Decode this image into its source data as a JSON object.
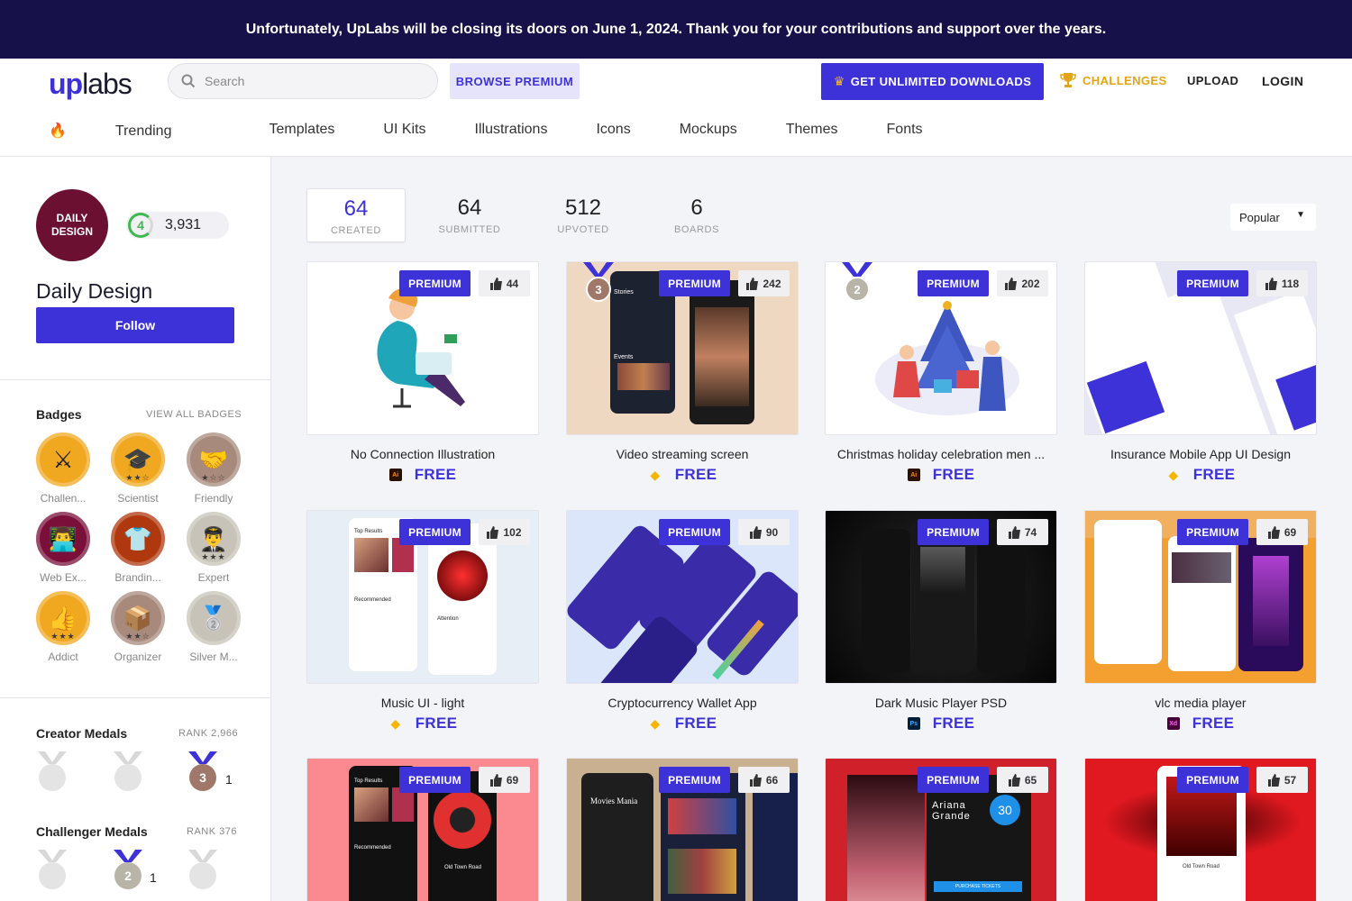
{
  "banner": {
    "text": "Unfortunately, UpLabs will be closing its doors on June 1, 2024. Thank you for your contributions and support over the years."
  },
  "header": {
    "logo_up": "up",
    "logo_labs": "labs",
    "search_placeholder": "Search",
    "browse_premium": "BROWSE PREMIUM",
    "unlimited": "GET UNLIMITED DOWNLOADS",
    "challenges": "CHALLENGES",
    "upload": "UPLOAD",
    "login": "LOGIN",
    "categories": [
      "Trending",
      "Templates",
      "UI Kits",
      "Illustrations",
      "Icons",
      "Mockups",
      "Themes",
      "Fonts"
    ],
    "accent": "#3d31d8"
  },
  "profile": {
    "avatar_text": "DAILY\nDESIGN",
    "level": "4",
    "points": "3,931",
    "name": "Daily Design",
    "follow": "Follow"
  },
  "badges": {
    "title": "Badges",
    "view_all": "VIEW ALL BADGES",
    "items": [
      {
        "label": "Challen...",
        "icon": "knight-icon",
        "glyph": "⚔",
        "stars": "",
        "color": "#f0a820"
      },
      {
        "label": "Scientist",
        "icon": "graduation-cap-icon",
        "glyph": "🎓",
        "stars": "★★☆",
        "color": "#f0a820"
      },
      {
        "label": "Friendly",
        "icon": "handshake-icon",
        "glyph": "🤝",
        "stars": "★☆☆",
        "color": "#a88a7c"
      },
      {
        "label": "Web Ex...",
        "icon": "developer-icon",
        "glyph": "👨‍💻",
        "stars": "",
        "color": "#7a0f3a"
      },
      {
        "label": "Brandin...",
        "icon": "tshirt-icon",
        "glyph": "👕",
        "stars": "",
        "color": "#b0380f"
      },
      {
        "label": "Expert",
        "icon": "expert-icon",
        "glyph": "👨‍✈️",
        "stars": "★★★",
        "color": "#c7c3b8"
      },
      {
        "label": "Addict",
        "icon": "thumbs-up-icon",
        "glyph": "👍",
        "stars": "★★★",
        "color": "#f0a820"
      },
      {
        "label": "Organizer",
        "icon": "box-icon",
        "glyph": "📦",
        "stars": "★★☆",
        "color": "#a88a7c"
      },
      {
        "label": "Silver M...",
        "icon": "silver-medal-icon",
        "glyph": "🥈",
        "stars": "",
        "color": "#c7c3b8"
      }
    ]
  },
  "creator_medals": {
    "title": "Creator Medals",
    "rank": "RANK 2,966",
    "bronze_count": "1",
    "bronze_num": "3"
  },
  "challenger_medals": {
    "title": "Challenger Medals",
    "rank": "RANK 376",
    "silver_count": "1",
    "silver_num": "2"
  },
  "stats": [
    {
      "num": "64",
      "label": "CREATED"
    },
    {
      "num": "64",
      "label": "SUBMITTED"
    },
    {
      "num": "512",
      "label": "UPVOTED"
    },
    {
      "num": "6",
      "label": "BOARDS"
    }
  ],
  "sort": {
    "selected": "Popular"
  },
  "cards": [
    {
      "title": "No Connection Illustration",
      "likes": "44",
      "price": "FREE",
      "app": "Ai",
      "premium": "PREMIUM"
    },
    {
      "title": "Video streaming screen",
      "likes": "242",
      "price": "FREE",
      "app": "Sketch",
      "premium": "PREMIUM",
      "medal": "3"
    },
    {
      "title": "Christmas holiday celebration men ...",
      "likes": "202",
      "price": "FREE",
      "app": "Ai",
      "premium": "PREMIUM",
      "medal": "2"
    },
    {
      "title": "Insurance Mobile App UI Design",
      "likes": "118",
      "price": "FREE",
      "app": "Sketch",
      "premium": "PREMIUM"
    },
    {
      "title": "Music UI - light",
      "likes": "102",
      "price": "FREE",
      "app": "Sketch",
      "premium": "PREMIUM"
    },
    {
      "title": "Cryptocurrency Wallet App",
      "likes": "90",
      "price": "FREE",
      "app": "Sketch",
      "premium": "PREMIUM"
    },
    {
      "title": "Dark Music Player PSD",
      "likes": "74",
      "price": "FREE",
      "app": "Ps",
      "premium": "PREMIUM"
    },
    {
      "title": "vlc media player",
      "likes": "69",
      "price": "FREE",
      "app": "Xd",
      "premium": "PREMIUM"
    },
    {
      "title": "",
      "likes": "69",
      "price": "",
      "app": "",
      "premium": "PREMIUM"
    },
    {
      "title": "",
      "likes": "66",
      "price": "",
      "app": "",
      "premium": "PREMIUM"
    },
    {
      "title": "",
      "likes": "65",
      "price": "",
      "app": "",
      "premium": "PREMIUM"
    },
    {
      "title": "",
      "likes": "57",
      "price": "",
      "app": "",
      "premium": "PREMIUM"
    }
  ],
  "thumb_text": {
    "c2_stories": "Stories",
    "c2_events": "Events",
    "c5_top": "Top Results",
    "c5_rec": "Recommended",
    "c5_track": "Attention",
    "c9_top": "Top Results",
    "c9_rec": "Recommended",
    "c9_track": "Old Town Road",
    "c10_title": "Movies Mania",
    "c11_artist": "Ariana Grande",
    "c11_days": "30",
    "c11_buy": "PURCHASE TICKETS",
    "c12_track": "Old Town Road"
  }
}
